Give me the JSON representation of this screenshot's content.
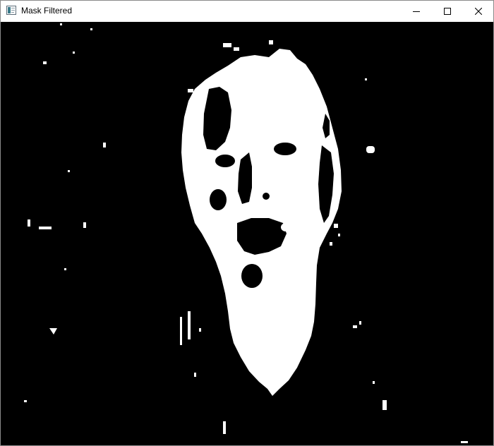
{
  "window": {
    "title": "Mask Filtered",
    "app_icon": "app-window-icon",
    "controls": {
      "minimize_icon": "minimize-icon",
      "maximize_icon": "maximize-icon",
      "close_icon": "close-icon"
    }
  },
  "image": {
    "kind": "binary-mask",
    "foreground_color": "#ffffff",
    "background_color": "#000000"
  }
}
